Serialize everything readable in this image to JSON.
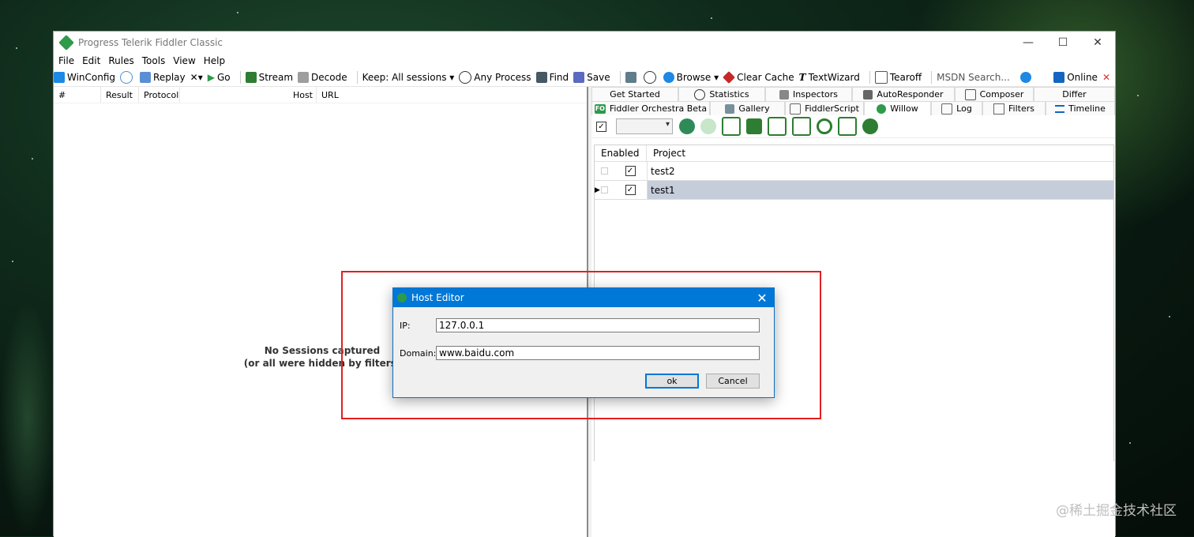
{
  "window": {
    "title": "Progress Telerik Fiddler Classic"
  },
  "menu": [
    "File",
    "Edit",
    "Rules",
    "Tools",
    "View",
    "Help"
  ],
  "toolbar": {
    "winconfig": "WinConfig",
    "replay": "Replay",
    "remove": "✕▾",
    "go": "Go",
    "stream": "Stream",
    "decode": "Decode",
    "keep": "Keep: All sessions ▾",
    "process": "Any Process",
    "find": "Find",
    "save": "Save",
    "browse": "Browse ▾",
    "clear_cache": "Clear Cache",
    "textwizard": "TextWizard",
    "tearoff": "Tearoff",
    "msdn": "MSDN Search...",
    "online": "Online",
    "close": "✕"
  },
  "sessions": {
    "columns": [
      "#",
      "Result",
      "Protocol",
      "Host",
      "URL"
    ],
    "empty_line1": "No Sessions captured",
    "empty_line2": "(or all were hidden by filters)"
  },
  "tabs_row1": [
    "Get Started",
    "Statistics",
    "Inspectors",
    "AutoResponder",
    "Composer",
    "Differ"
  ],
  "tabs_row2": [
    "Fiddler Orchestra Beta",
    "Gallery",
    "FiddlerScript",
    "Willow",
    "Log",
    "Filters",
    "Timeline"
  ],
  "willow": {
    "columns": [
      "Enabled",
      "Project"
    ],
    "rows": [
      {
        "project": "test2",
        "enabled": true,
        "selected": false
      },
      {
        "project": "test1",
        "enabled": true,
        "selected": true
      }
    ]
  },
  "dialog": {
    "title": "Host Editor",
    "ip_label": "IP:",
    "ip_value": "127.0.0.1",
    "domain_label": "Domain:",
    "domain_value": "www.baidu.com",
    "ok_label": "ok",
    "cancel_label": "Cancel"
  },
  "watermark": "@稀土掘金技术社区",
  "colors": {
    "accent": "#0078d7",
    "highlight_frame": "#e02020",
    "selected_row": "#c5cdda"
  }
}
